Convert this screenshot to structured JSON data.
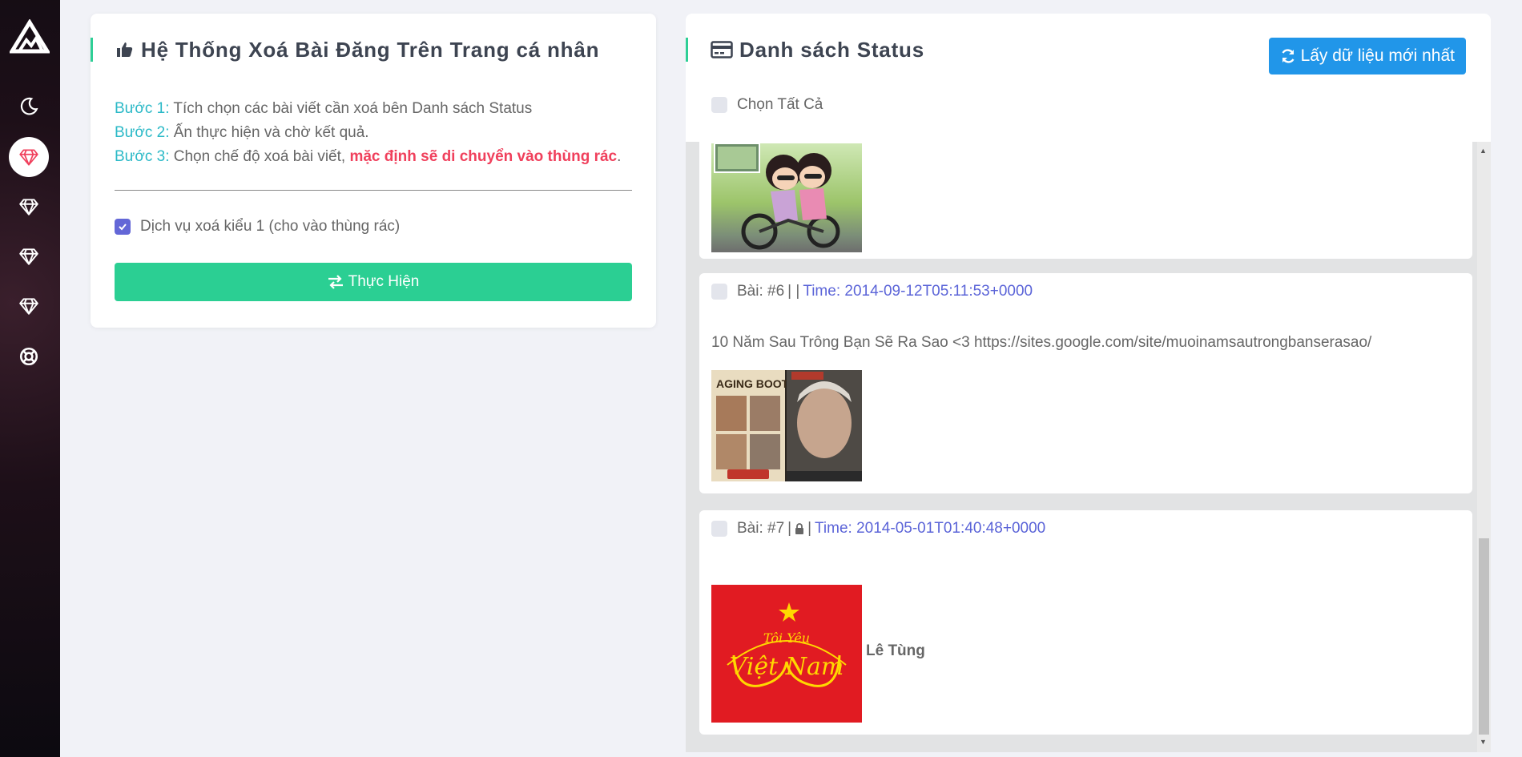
{
  "sidebar": {
    "logo": "mountain-logo",
    "items": [
      {
        "icon": "moon-icon"
      },
      {
        "icon": "diamond-icon",
        "active": true
      },
      {
        "icon": "diamond-icon"
      },
      {
        "icon": "diamond-icon"
      },
      {
        "icon": "diamond-icon"
      },
      {
        "icon": "lifebuoy-icon"
      }
    ]
  },
  "left_card": {
    "title": "Hệ Thống Xoá Bài Đăng Trên Trang cá nhân",
    "title_icon": "thumbs-up-icon",
    "steps": [
      {
        "label": "Bước 1:",
        "text": " Tích chọn các bài viết cần xoá bên Danh sách Status"
      },
      {
        "label": "Bước 2:",
        "text": " Ấn thực hiện và chờ kết quả."
      },
      {
        "label": "Bước 3:",
        "text": " Chọn chế độ xoá bài viết, ",
        "highlight": "mặc định sẽ di chuyển vào thùng rác",
        "suffix": "."
      }
    ],
    "option_label": "Dịch vụ xoá kiểu 1 (cho vào thùng rác)",
    "option_checked": true,
    "execute_label": "Thực Hiện",
    "execute_icon": "exchange-icon"
  },
  "right_card": {
    "title": "Danh sách Status",
    "title_icon": "credit-card-icon",
    "refresh_label": "Lấy dữ liệu mới nhất",
    "refresh_icon": "refresh-icon",
    "select_all_label": "Chọn Tất Cả",
    "posts": [
      {
        "id": "post-5",
        "partial": true,
        "image": "couple-on-bike-cartoon"
      },
      {
        "id": "post-6",
        "label": "Bài: #6",
        "privacy": "",
        "time": "Time: 2014-09-12T05:11:53+0000",
        "content": "10 Năm Sau Trông Bạn Sẽ Ra Sao <3 https://sites.google.com/site/muoinamsautrongbanserasao/",
        "image": "aging-booth-screenshot"
      },
      {
        "id": "post-7",
        "label": "Bài: #7",
        "privacy": "lock-icon",
        "time": "Time: 2014-05-01T01:40:48+0000",
        "content": "",
        "image": "toi-yeu-viet-nam-logo",
        "caption": "Lê Tùng",
        "image_text": "Tôi Yêu Việt Nam"
      }
    ]
  },
  "colors": {
    "accent_green": "#2bcf93",
    "accent_blue": "#2196e9",
    "step_label": "#2bb9c7",
    "highlight_red": "#f0405c",
    "time_blue": "#5b64d8",
    "checkbox_checked": "#6367d7"
  }
}
